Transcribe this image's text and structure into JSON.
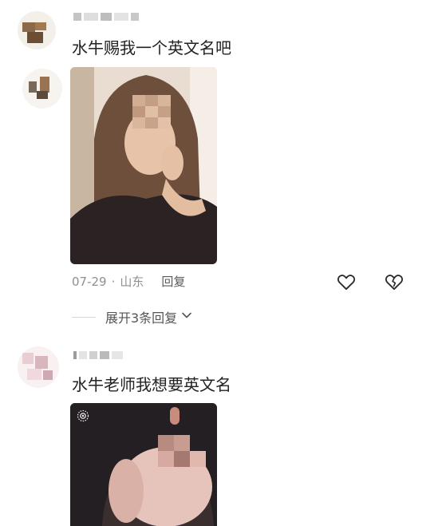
{
  "comments": [
    {
      "text": "水牛赐我一个英文名吧",
      "date": "07-29",
      "separator": "·",
      "location": "山东",
      "reply_label": "回复",
      "expand_label": "展开3条回复"
    },
    {
      "text": "水牛老师我想要英文名"
    }
  ],
  "icons": {
    "like": "heart-icon",
    "dislike": "broken-heart-icon",
    "expand": "chevron-down-icon",
    "live": "live-indicator-icon"
  },
  "colors": {
    "meta_text": "#8f8f8f",
    "body_text": "#222222"
  }
}
